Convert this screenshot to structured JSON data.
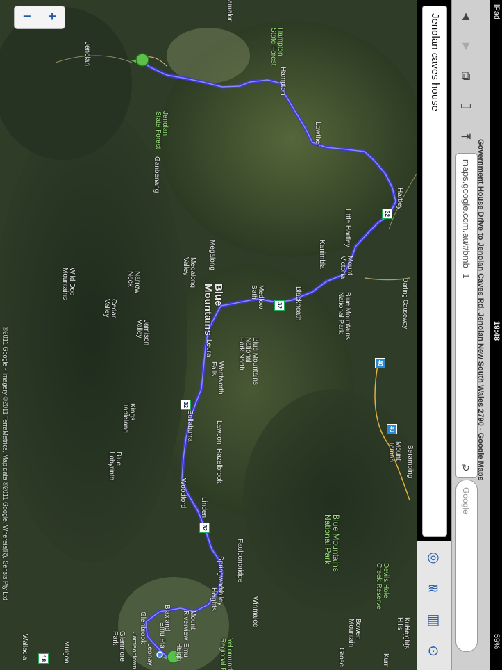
{
  "status_bar": {
    "device": "iPad",
    "time": "19:48",
    "battery": "59%"
  },
  "browser": {
    "page_title": "Government House Drive to Jenolan Caves Rd, Jenolan New South Wales 2790 - Google Maps",
    "url": "maps.google.com.au/#bmb=1",
    "search_placeholder": "Google",
    "icons": [
      "back-icon",
      "forward-icon",
      "tabs-icon",
      "bookmarks-icon",
      "share-icon",
      "reload-icon"
    ]
  },
  "maps": {
    "search_query": "Jenolan caves house",
    "zoom_out": "−",
    "zoom_in": "+",
    "marker_a": "A",
    "marker_b": "B",
    "copyright": "©2011 Google - Imagery ©2011 TerraMetrics, Map data ©2011 Google, Whereis(R), Sensis Pty Ltd",
    "labels": {
      "jenolan": "Jenolan",
      "jenolan_sf": "Jenolan\nState Forest",
      "hampton_sf": "Hampton\nState Forest",
      "hampton": "Hampton",
      "ganbenang": "Ganbenang",
      "lowther": "Lowther",
      "hartley": "Hartley",
      "little_hartley": "Little Hartley",
      "mount_victoria": "Mount\nVictoria",
      "kanimbla": "Kanimbla",
      "blackheath": "Blackheath",
      "darling_causeway": "Darling Causeway",
      "bm_np": "Blue Mountains\nNational Park",
      "megalong": "Megalong",
      "megalong_valley": "Megalong\nValley",
      "medlow_bath": "Medlow\nBath",
      "blue_mountains": "Blue\nMountains",
      "leura": "Leura",
      "bm_np_north": "Blue Mountains\nNational\nPark North",
      "wentworth_falls": "Wentworth\nFalls",
      "wild_dog": "Wild Dog\nMountains",
      "narrow_neck": "Narrow\nNeck",
      "cedar_valley": "Cedar\nValley",
      "jamison_valley": "Jamison\nValley",
      "kings_tableland": "Kings\nTableland",
      "bullaburra": "Bullaburra",
      "lawson": "Lawson",
      "hazelbrook": "Hazelbrook",
      "blue_labyrinth": "Blue\nLabyrinth",
      "woodford": "Woodford",
      "linden": "Linden",
      "faulconbridge": "Faulconbridge",
      "springwood": "Springwood",
      "valley_heights": "Valley\nHeights",
      "winmalee": "Winmalee",
      "blaxland": "Blaxland",
      "mount_riverview": "Mount\nRiverview",
      "glenbrook": "Glenbrook",
      "emu_plains": "Emu Pla",
      "leonay": "Leonay",
      "glenmore_park": "Glenmore\nPark",
      "wallacia": "Wallacia",
      "mulgoa": "Mulgoa",
      "jamisontown": "Jamisontown",
      "mount_tomah": "Mount\nTomah",
      "berambing": "Berambing",
      "bm_np_big": "Blue Mountains\nNational Park",
      "devils_hole": "Devils Hole\nCreek Reserve",
      "kurrajong_hills": "Kurrajong\nHills",
      "bowen_mountain": "Bowen\nMountain",
      "grose": "Grose",
      "heights": "Heights",
      "kurr": "Kurr",
      "yellomund": "Yellomund\nRegional P",
      "emu_heights": "Emu\nHeigh",
      "camalor": "amalor"
    },
    "shields": {
      "s32a": "32",
      "s32b": "32",
      "s40a": "40",
      "s40b": "40",
      "s32c": "32",
      "s32d": "32",
      "s18": "18"
    }
  }
}
